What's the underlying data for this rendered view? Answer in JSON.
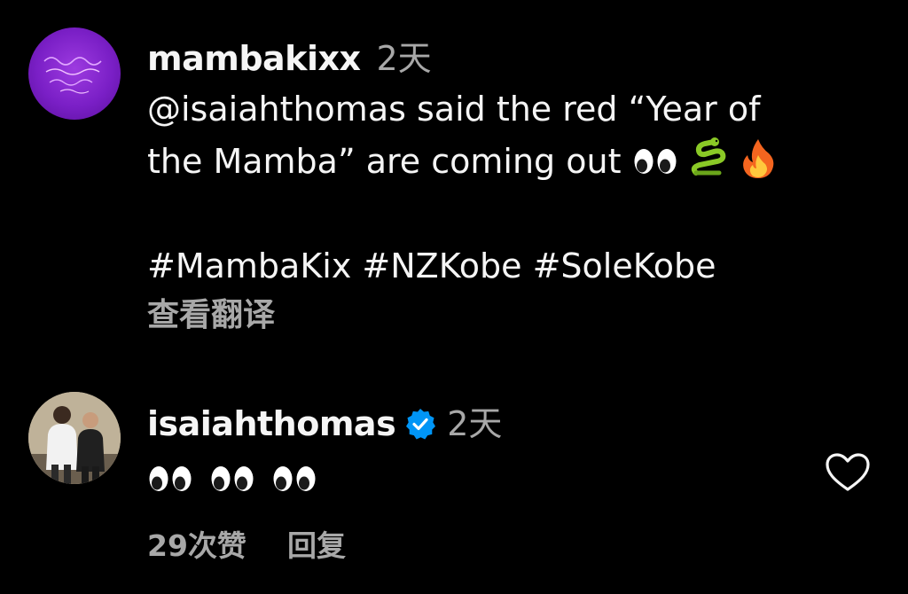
{
  "comments": [
    {
      "username": "mambakixx",
      "timestamp": "2天",
      "text_line1": "@isaiahthomas said the red “Year of",
      "text_line2": "the Mamba” are coming out",
      "hashtags": [
        "#MambaKix",
        "#NZKobe",
        "#SoleKobe"
      ],
      "see_translation": "查看翻译",
      "emoji": [
        "eyes",
        "snake",
        "fire"
      ],
      "avatar_color": "#7a1fc6"
    },
    {
      "username": "isaiahthomas",
      "verified": true,
      "timestamp": "2天",
      "emoji": [
        "eyes",
        "eyes",
        "eyes"
      ],
      "likes_label": "29次赞",
      "reply_label": "回复",
      "verified_color": "#0095f6"
    }
  ]
}
